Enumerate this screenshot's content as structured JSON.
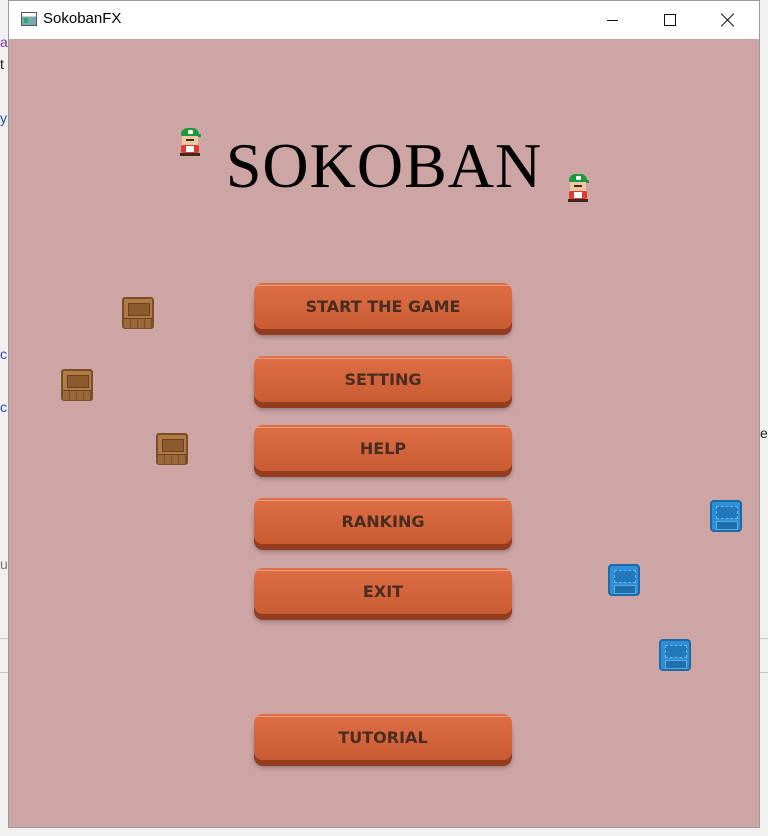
{
  "window": {
    "title": "SokobanFX",
    "minimize_glyph": "minimize",
    "maximize_glyph": "maximize",
    "close_glyph": "close"
  },
  "game": {
    "logo": "SOKOBAN",
    "background_color": "#cda5a5",
    "button_color": "#d9663c",
    "menu": {
      "start": "START THE GAME",
      "setting": "SETTING",
      "help": "HELP",
      "ranking": "RANKING",
      "exit": "EXIT",
      "tutorial": "TUTORIAL"
    },
    "sprites": {
      "player": "player-icon",
      "crate": "crate-icon",
      "target": "target-icon"
    }
  },
  "background_fragments": [
    "a",
    "t",
    "y",
    "c",
    "c",
    "u",
    "e"
  ]
}
